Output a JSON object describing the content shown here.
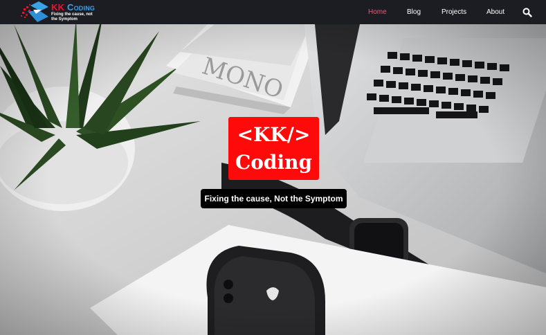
{
  "navbar": {
    "logo": {
      "title_kk": "KK",
      "title_coding": "Coding",
      "tagline": "Fixing the cause, not the Symptom",
      "icon": "kk-logo-icon"
    },
    "links": [
      {
        "label": "Home",
        "active": true
      },
      {
        "label": "Blog",
        "active": false
      },
      {
        "label": "Projects",
        "active": false
      },
      {
        "label": "About",
        "active": false
      }
    ],
    "search_icon": "search-icon",
    "active_color": "#ee5a72",
    "background": "#1c1d22"
  },
  "hero": {
    "title_line1": "<KK/>",
    "title_line2": "Coding",
    "tagline": "Fixing the cause, Not the Symptom",
    "title_bg": "#ff0a0a",
    "tagline_bg": "#000000",
    "background_image": "desk-with-laptop-phone-watch-plant"
  }
}
